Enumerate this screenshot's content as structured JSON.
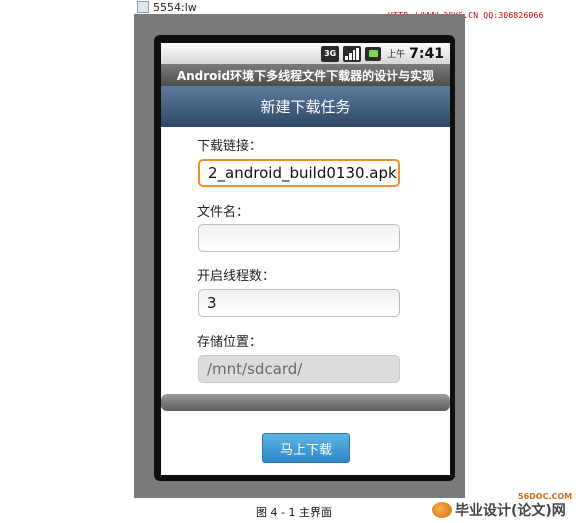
{
  "window": {
    "title": "5554:lw"
  },
  "watermark_top": "HTTP://WWW.28YS.CN QQ:306826066",
  "statusbar": {
    "network": "3G",
    "ampm": "上午",
    "time": "7:41"
  },
  "app": {
    "title": "Android环境下多线程文件下载器的设计与实现"
  },
  "header": {
    "title": "新建下载任务"
  },
  "form": {
    "url_label": "下载链接：",
    "url_value": "2_android_build0130.apk",
    "filename_label": "文件名：",
    "filename_value": "",
    "threads_label": "开启线程数：",
    "threads_value": "3",
    "path_label": "存储位置：",
    "path_value": "/mnt/sdcard/"
  },
  "buttons": {
    "start_label": "马上下载"
  },
  "caption": "图 4 - 1 主界面",
  "watermark_bottom_small": "56DOC.COM",
  "watermark_bottom": "毕业设计(论文)网",
  "colors": {
    "header": "#3f5a7d",
    "focus": "#f0922c",
    "button": "#3b9bd6",
    "battery": "#7ed84a"
  }
}
